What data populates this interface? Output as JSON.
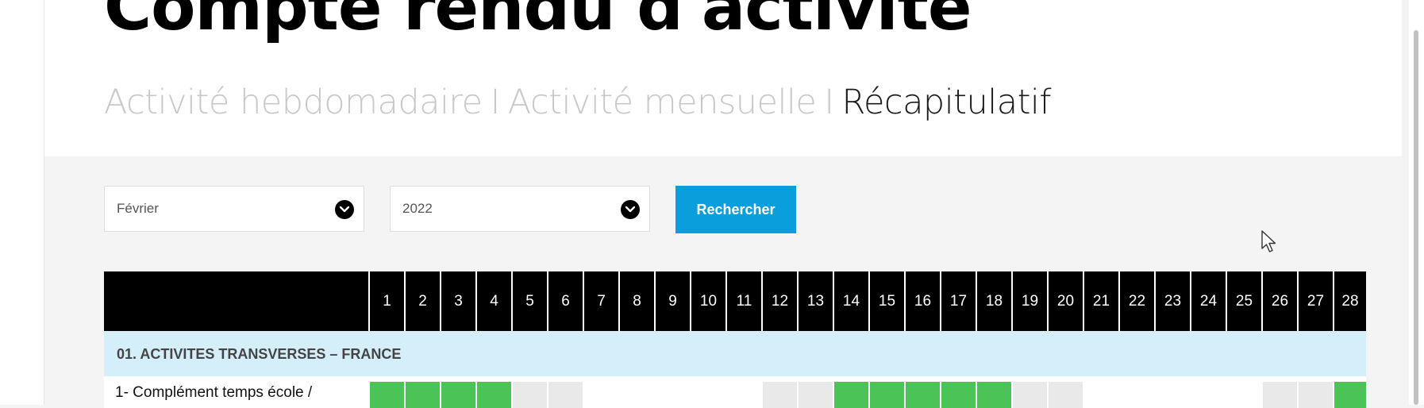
{
  "page": {
    "title": "Compte rendu d'activité",
    "nav": {
      "weekly": "Activité hebdomadaire",
      "monthly": "Activité mensuelle",
      "summary": "Récapitulatif",
      "separator": "I"
    }
  },
  "filters": {
    "month": "Février",
    "year": "2022",
    "search_label": "Rechercher"
  },
  "calendar": {
    "days": [
      "1",
      "2",
      "3",
      "4",
      "5",
      "6",
      "7",
      "8",
      "9",
      "10",
      "11",
      "12",
      "13",
      "14",
      "15",
      "16",
      "17",
      "18",
      "19",
      "20",
      "21",
      "22",
      "23",
      "24",
      "25",
      "26",
      "27",
      "28"
    ],
    "section_label": "01. ACTIVITES TRANSVERSES – FRANCE",
    "activity_label": "1- Complément temps école /",
    "day_status": [
      "filled",
      "filled",
      "filled",
      "filled",
      "weekend",
      "weekend",
      "empty",
      "empty",
      "empty",
      "empty",
      "empty",
      "weekend",
      "weekend",
      "filled",
      "filled",
      "filled",
      "filled",
      "filled",
      "weekend",
      "weekend",
      "empty",
      "empty",
      "empty",
      "empty",
      "empty",
      "weekend",
      "weekend",
      "filled"
    ]
  },
  "colors": {
    "filled": "#4cc357",
    "weekend": "#e9e9e9",
    "empty": "#ffffff",
    "accent": "#0a9fdc",
    "section_bg": "#d5effa"
  }
}
